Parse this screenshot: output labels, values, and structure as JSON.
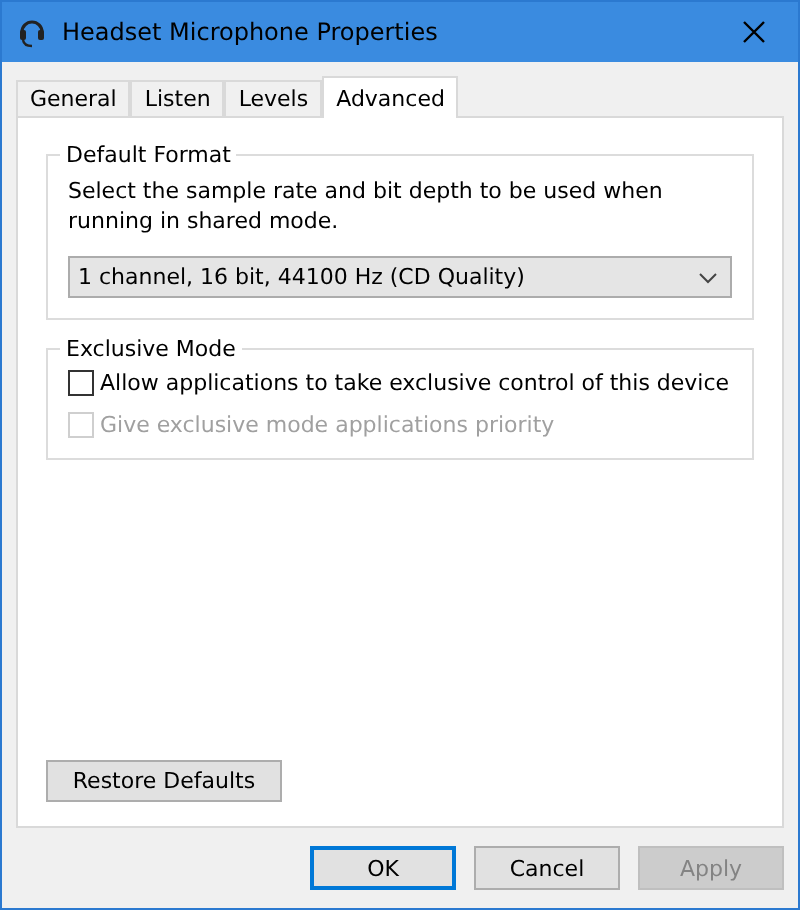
{
  "window": {
    "title": "Headset Microphone Properties"
  },
  "tabs": [
    {
      "label": "General",
      "selected": false
    },
    {
      "label": "Listen",
      "selected": false
    },
    {
      "label": "Levels",
      "selected": false
    },
    {
      "label": "Advanced",
      "selected": true
    }
  ],
  "default_format": {
    "title": "Default Format",
    "description": "Select the sample rate and bit depth to be used when running in shared mode.",
    "dropdown": {
      "value": "1 channel, 16 bit, 44100 Hz (CD Quality)"
    }
  },
  "exclusive_mode": {
    "title": "Exclusive Mode",
    "options": [
      {
        "label": "Allow applications to take exclusive control of this device",
        "checked": false,
        "disabled": false
      },
      {
        "label": "Give exclusive mode applications priority",
        "checked": false,
        "disabled": true
      }
    ]
  },
  "restore_button": "Restore Defaults",
  "buttons": [
    {
      "label": "OK",
      "default": true,
      "disabled": false
    },
    {
      "label": "Cancel",
      "default": false,
      "disabled": false
    },
    {
      "label": "Apply",
      "default": false,
      "disabled": true
    }
  ]
}
